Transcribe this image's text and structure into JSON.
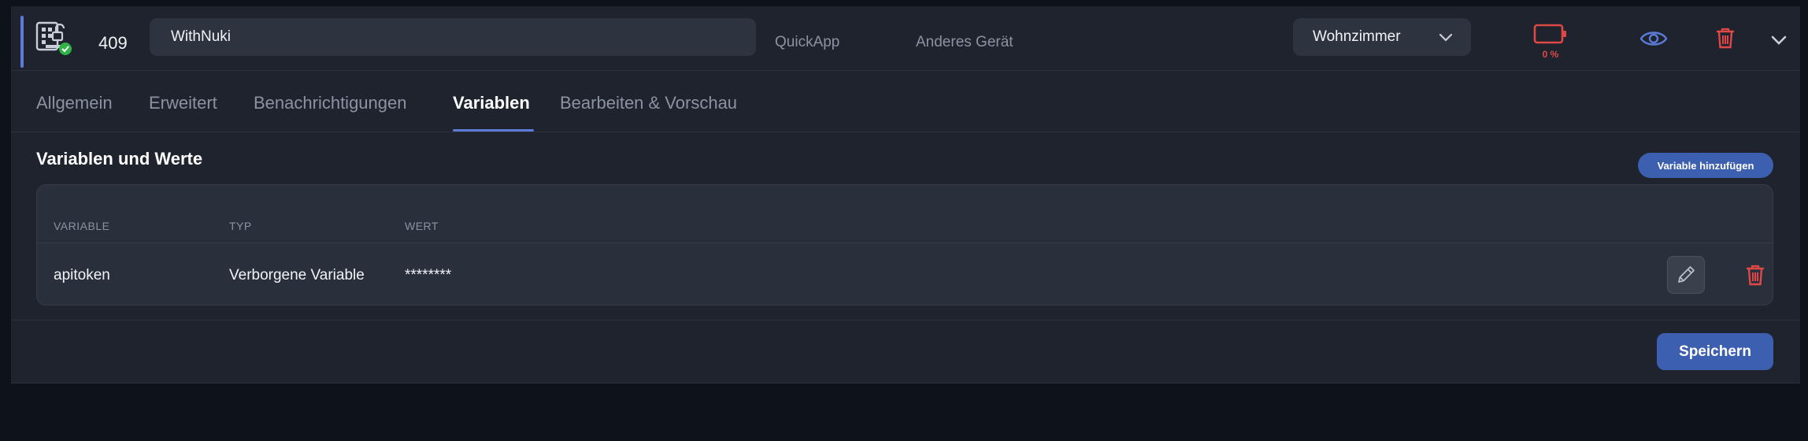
{
  "device": {
    "id": "409",
    "name_value": "WithNuki",
    "type": "QuickApp",
    "category": "Anderes Gerät",
    "room": "Wohnzimmer",
    "battery": "0 %",
    "icons": {
      "device": "device-status-icon",
      "visibility": "eye-icon",
      "delete": "trash-icon",
      "expand": "chevron-down-icon",
      "battery": "battery-empty-icon"
    }
  },
  "tabs": [
    {
      "label": "Allgemein",
      "active": false
    },
    {
      "label": "Erweitert",
      "active": false
    },
    {
      "label": "Benachrichtigungen",
      "active": false
    },
    {
      "label": "Variablen",
      "active": true
    },
    {
      "label": "Bearbeiten & Vorschau",
      "active": false
    }
  ],
  "section": {
    "title": "Variablen und Werte",
    "add_button": "Variable hinzufügen"
  },
  "table": {
    "headers": [
      "VARIABLE",
      "TYP",
      "WERT"
    ],
    "rows": [
      {
        "variable": "apitoken",
        "type": "Verborgene Variable",
        "value": "********"
      }
    ]
  },
  "footer": {
    "save_label": "Speichern"
  },
  "colors": {
    "accent": "#5b7bd6",
    "primary_button": "#3d5fb0",
    "danger": "#e04848",
    "success": "#2fb344"
  }
}
